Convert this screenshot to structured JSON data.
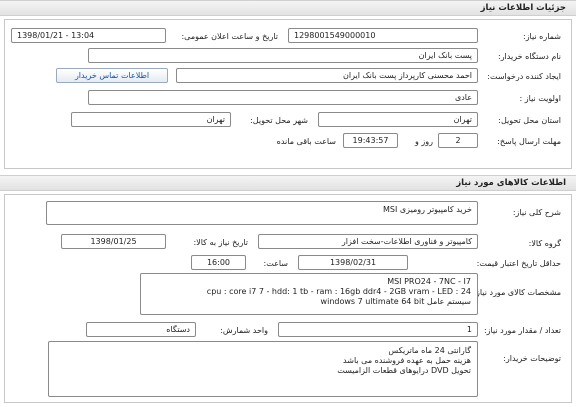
{
  "header": {
    "title": "جزئیات اطلاعات نیاز"
  },
  "need_info": {
    "need_number_label": "شماره نیاز:",
    "need_number": "1298001549000010",
    "announce_label": "تاریخ و ساعت اعلان عمومی:",
    "announce_value": "1398/01/21 - 13:04",
    "buyer_org_label": "نام دستگاه خریدار:",
    "buyer_org": "پست بانک ایران",
    "creator_label": "ایجاد کننده درخواست:",
    "creator": "احمد  محسنی کارپرداز پست بانک ایران",
    "contact_button": "اطلاعات تماس خریدار",
    "priority_label": "اولویت نیاز :",
    "priority": "عادی",
    "province_label": "استان محل تحویل:",
    "province": "تهران",
    "city_label": "شهر محل تحویل:",
    "city": "تهران",
    "deadline_label": "مهلت ارسال پاسخ:",
    "days": "2",
    "days_unit": "روز و",
    "time_left": "19:43:57",
    "time_left_suffix": "ساعت باقی مانده"
  },
  "goods": {
    "title": "اطلاعات کالاهای مورد نیاز",
    "summary_label": "شرح کلی نیاز:",
    "summary": "خرید کامپیوتر رومیزی MSI",
    "group_label": "گروه کالا:",
    "group": "کامپیوتر و فناوری اطلاعات-سخت افزار",
    "need_date_label": "تاریخ نیاز به کالا:",
    "need_date": "1398/01/25",
    "validity_label": "حداقل تاریخ اعتبار قیمت:",
    "validity_date": "1398/02/31",
    "hour_label": "ساعت:",
    "hour": "16:00",
    "spec_label": "مشخصات کالای مورد نیاز:",
    "spec_lines": [
      "MSI PRO24 - 7NC - I7",
      "cpu : core i7 7 - hdd: 1 tb - ram : 16gb ddr4 - 2GB vram - LED : 24",
      "سیستم عامل windows 7 ultimate 64 bit"
    ],
    "qty_label": "تعداد / مقدار مورد نیاز:",
    "qty": "1",
    "unit_label": "واحد شمارش:",
    "unit": "دستگاه",
    "notes_label": "توضیحات خریدار:",
    "notes_lines": [
      "گارانتی 24 ماه ماتریکس",
      "هزینه حمل به عهده فروشنده می باشد",
      "تحویل DVD درایوهای قطعات الزامیست"
    ]
  }
}
